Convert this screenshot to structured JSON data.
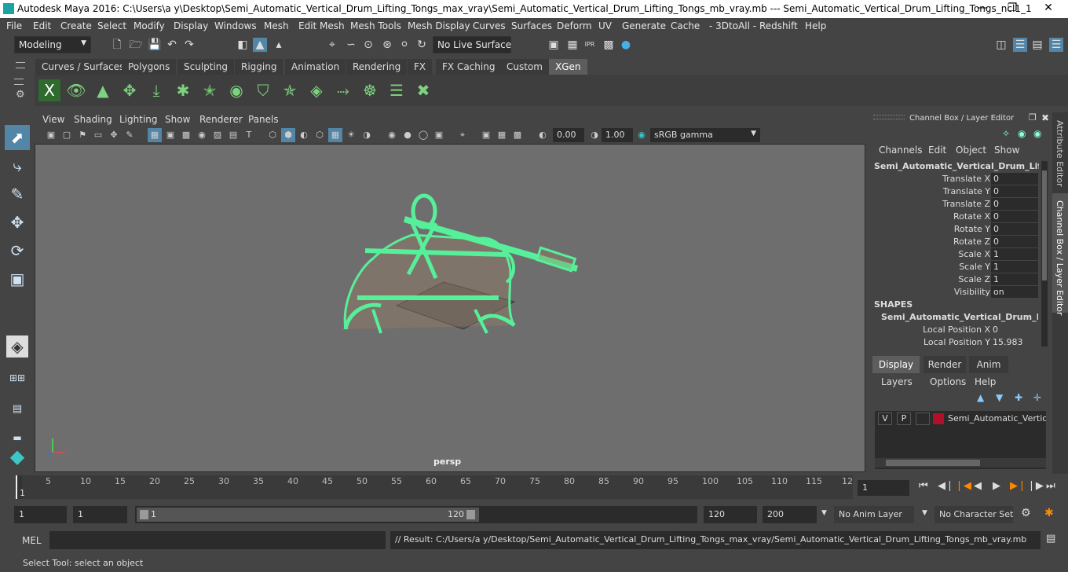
{
  "titlebar": {
    "title": "Autodesk Maya 2016: C:\\Users\\a y\\Desktop\\Semi_Automatic_Vertical_Drum_Lifting_Tongs_max_vray\\Semi_Automatic_Vertical_Drum_Lifting_Tongs_mb_vray.mb  ---  Semi_Automatic_Vertical_Drum_Lifting_Tongs_ncl1_1"
  },
  "menubar": [
    "File",
    "Edit",
    "Create",
    "Select",
    "Modify",
    "Display",
    "Windows",
    "Mesh",
    "Edit Mesh",
    "Mesh Tools",
    "Mesh Display",
    "Curves",
    "Surfaces",
    "Deform",
    "UV",
    "Generate",
    "Cache",
    "- 3DtoAll -",
    "Redshift",
    "Help"
  ],
  "statusline": {
    "mode": "Modeling",
    "live_surface": "No Live Surface"
  },
  "shelf_tabs": [
    "Curves / Surfaces",
    "Polygons",
    "Sculpting",
    "Rigging",
    "Animation",
    "Rendering",
    "FX",
    "FX Caching",
    "Custom",
    "XGen"
  ],
  "shelf_active": "XGen",
  "panel": {
    "menus": [
      "View",
      "Shading",
      "Lighting",
      "Show",
      "Renderer",
      "Panels"
    ],
    "exposure": "0.00",
    "gamma": "1.00",
    "colorspace": "sRGB gamma",
    "camera_label": "persp"
  },
  "channelbox": {
    "title": "Channel Box / Layer Editor",
    "menus": [
      "Channels",
      "Edit",
      "Object",
      "Show"
    ],
    "object": "Semi_Automatic_Vertical_Drum_Liftin...",
    "attrs": [
      {
        "name": "Translate X",
        "value": "0"
      },
      {
        "name": "Translate Y",
        "value": "0"
      },
      {
        "name": "Translate Z",
        "value": "0"
      },
      {
        "name": "Rotate X",
        "value": "0"
      },
      {
        "name": "Rotate Y",
        "value": "0"
      },
      {
        "name": "Rotate Z",
        "value": "0"
      },
      {
        "name": "Scale X",
        "value": "1"
      },
      {
        "name": "Scale Y",
        "value": "1"
      },
      {
        "name": "Scale Z",
        "value": "1"
      },
      {
        "name": "Visibility",
        "value": "on"
      }
    ],
    "shapes_label": "SHAPES",
    "shape_name": "Semi_Automatic_Vertical_Drum_Lifti...",
    "shape_attrs": [
      {
        "name": "Local Position X",
        "value": "0"
      },
      {
        "name": "Local Position Y",
        "value": "15.983"
      }
    ]
  },
  "sidetabs": [
    "Attribute Editor",
    "Channel Box / Layer Editor"
  ],
  "layers": {
    "tabs": [
      "Display",
      "Render",
      "Anim"
    ],
    "menus": [
      "Layers",
      "Options",
      "Help"
    ],
    "row": {
      "v": "V",
      "p": "P",
      "name": "Semi_Automatic_Vertical",
      "color": "#b0102a"
    }
  },
  "timeslider": {
    "ticks": [
      "5",
      "10",
      "15",
      "20",
      "25",
      "30",
      "35",
      "40",
      "45",
      "50",
      "55",
      "60",
      "65",
      "70",
      "75",
      "80",
      "85",
      "90",
      "95",
      "100",
      "105",
      "110",
      "115",
      "12"
    ],
    "current": "1",
    "current_field": "1"
  },
  "range": {
    "start": "1",
    "start2": "1",
    "slider_start": "1",
    "slider_end": "120",
    "end": "120",
    "end2": "200",
    "anim_layer": "No Anim Layer",
    "char_set": "No Character Set"
  },
  "cmd": {
    "label": "MEL",
    "result": "// Result: C:/Users/a y/Desktop/Semi_Automatic_Vertical_Drum_Lifting_Tongs_max_vray/Semi_Automatic_Vertical_Drum_Lifting_Tongs_mb_vray.mb"
  },
  "help": {
    "text": "Select Tool: select an object"
  },
  "colors": {
    "accent": "#5285a6",
    "wire": "#57f09a",
    "mesh_fill": "#c8a070"
  }
}
